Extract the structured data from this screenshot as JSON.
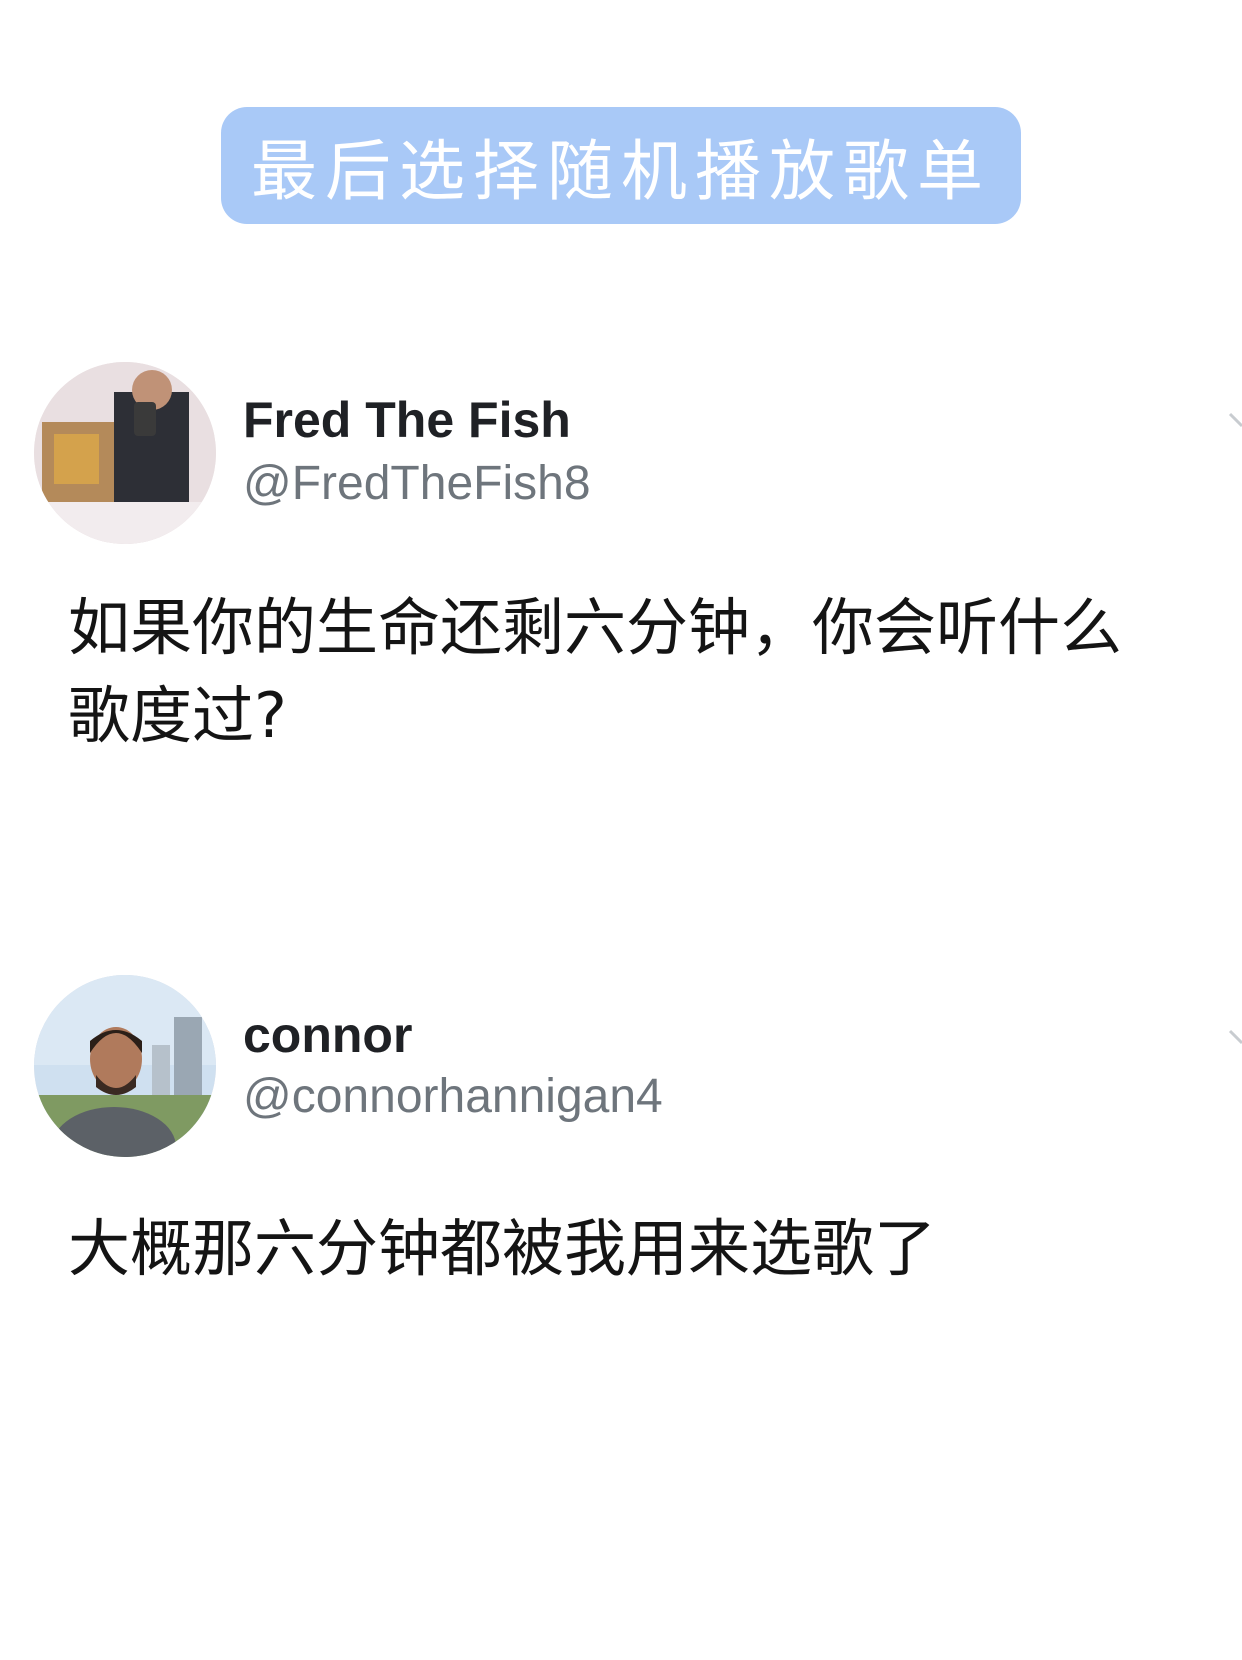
{
  "banner": {
    "text": "最后选择随机播放歌单",
    "color": "#a9c9f7"
  },
  "tweets": [
    {
      "display_name": "Fred The Fish",
      "handle": "@FredTheFish8",
      "text": "如果你的生命还剩六分钟，你会听什么歌度过?",
      "avatar_icon": "user-avatar-icon"
    },
    {
      "display_name": "connor",
      "handle": "@connorhannigan4",
      "text": "大概那六分钟都被我用来选歌了",
      "avatar_icon": "user-avatar-icon"
    }
  ]
}
